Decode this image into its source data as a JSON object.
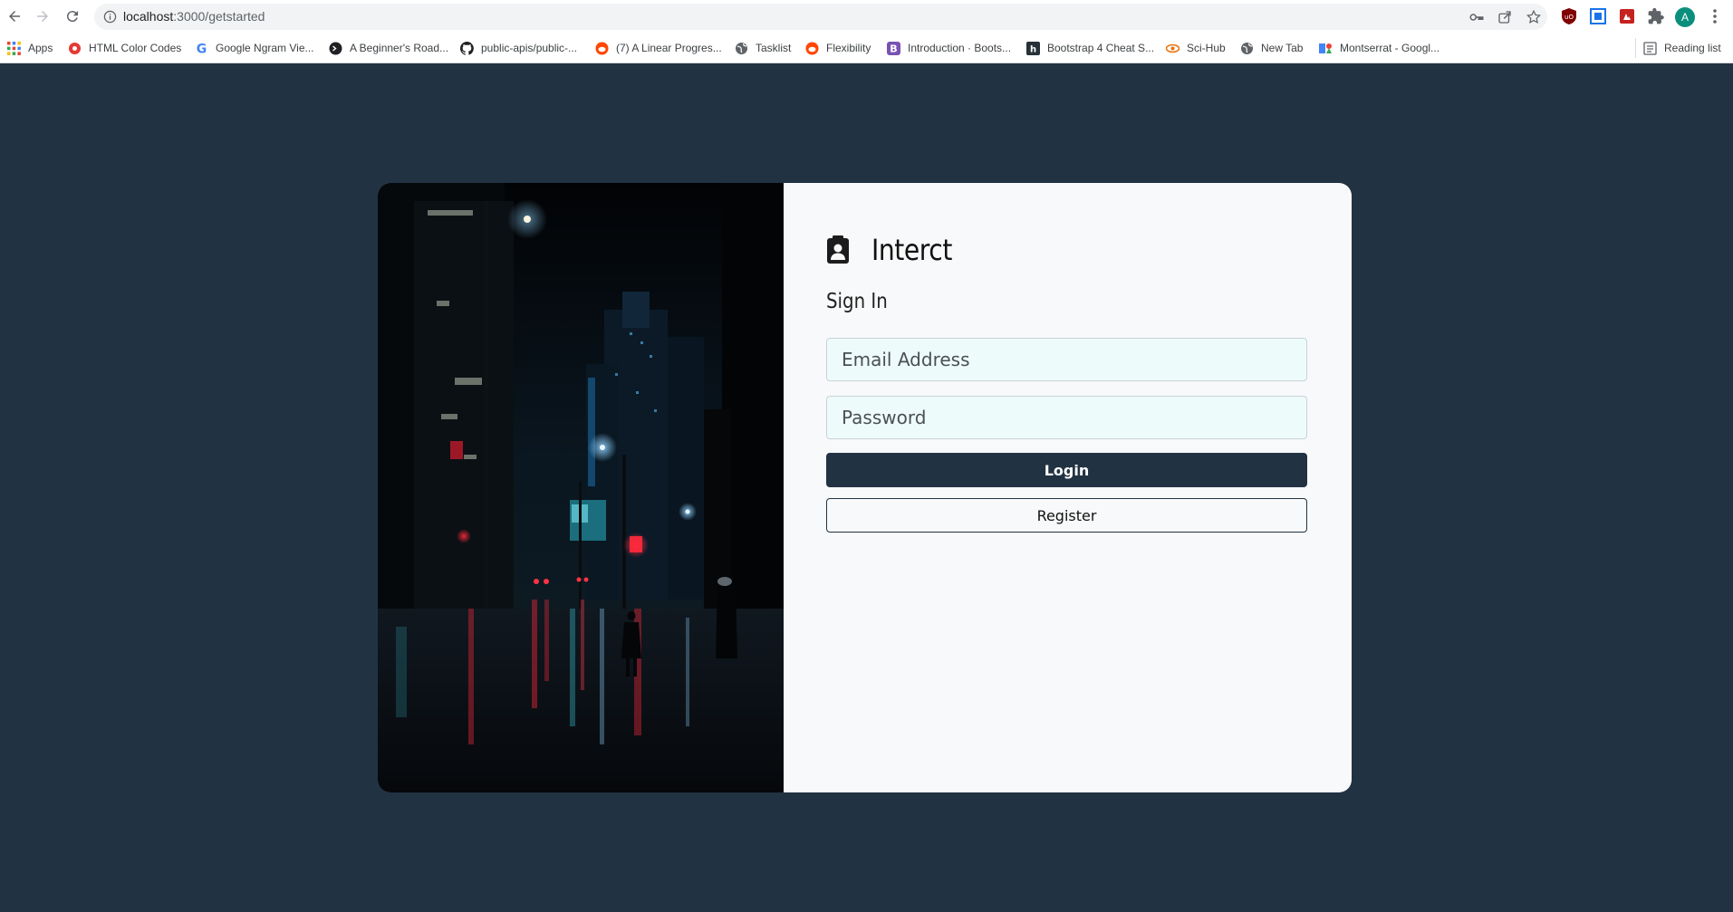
{
  "browser": {
    "url_host": "localhost",
    "url_path": ":3000/getstarted",
    "profile_initial": "A",
    "bookmarks": [
      {
        "label": "Apps",
        "icon": "apps-grid-icon"
      },
      {
        "label": "HTML Color Codes",
        "icon": "html-color-codes-icon"
      },
      {
        "label": "Google Ngram Vie...",
        "icon": "google-icon"
      },
      {
        "label": "A Beginner's Road...",
        "icon": "terminal-icon"
      },
      {
        "label": "public-apis/public-...",
        "icon": "github-icon"
      },
      {
        "label": "(7) A Linear Progres...",
        "icon": "reddit-icon"
      },
      {
        "label": "Tasklist",
        "icon": "globe-icon"
      },
      {
        "label": "Flexibility",
        "icon": "reddit-icon"
      },
      {
        "label": "Introduction · Boots...",
        "icon": "bootstrap-icon"
      },
      {
        "label": "Bootstrap 4 Cheat S...",
        "icon": "h-icon"
      },
      {
        "label": "Sci-Hub",
        "icon": "scihub-icon"
      },
      {
        "label": "New Tab",
        "icon": "globe-icon"
      },
      {
        "label": "Montserrat - Googl...",
        "icon": "google-fonts-icon"
      }
    ],
    "reading_list": "Reading list"
  },
  "app": {
    "name": "Interct",
    "heading": "Sign In",
    "email_placeholder": "Email Address",
    "password_placeholder": "Password",
    "login_label": "Login",
    "register_label": "Register"
  },
  "colors": {
    "page_bg": "#213243",
    "card_bg": "#f8f9fa",
    "input_bg": "#eefbfb",
    "primary": "#213243"
  }
}
